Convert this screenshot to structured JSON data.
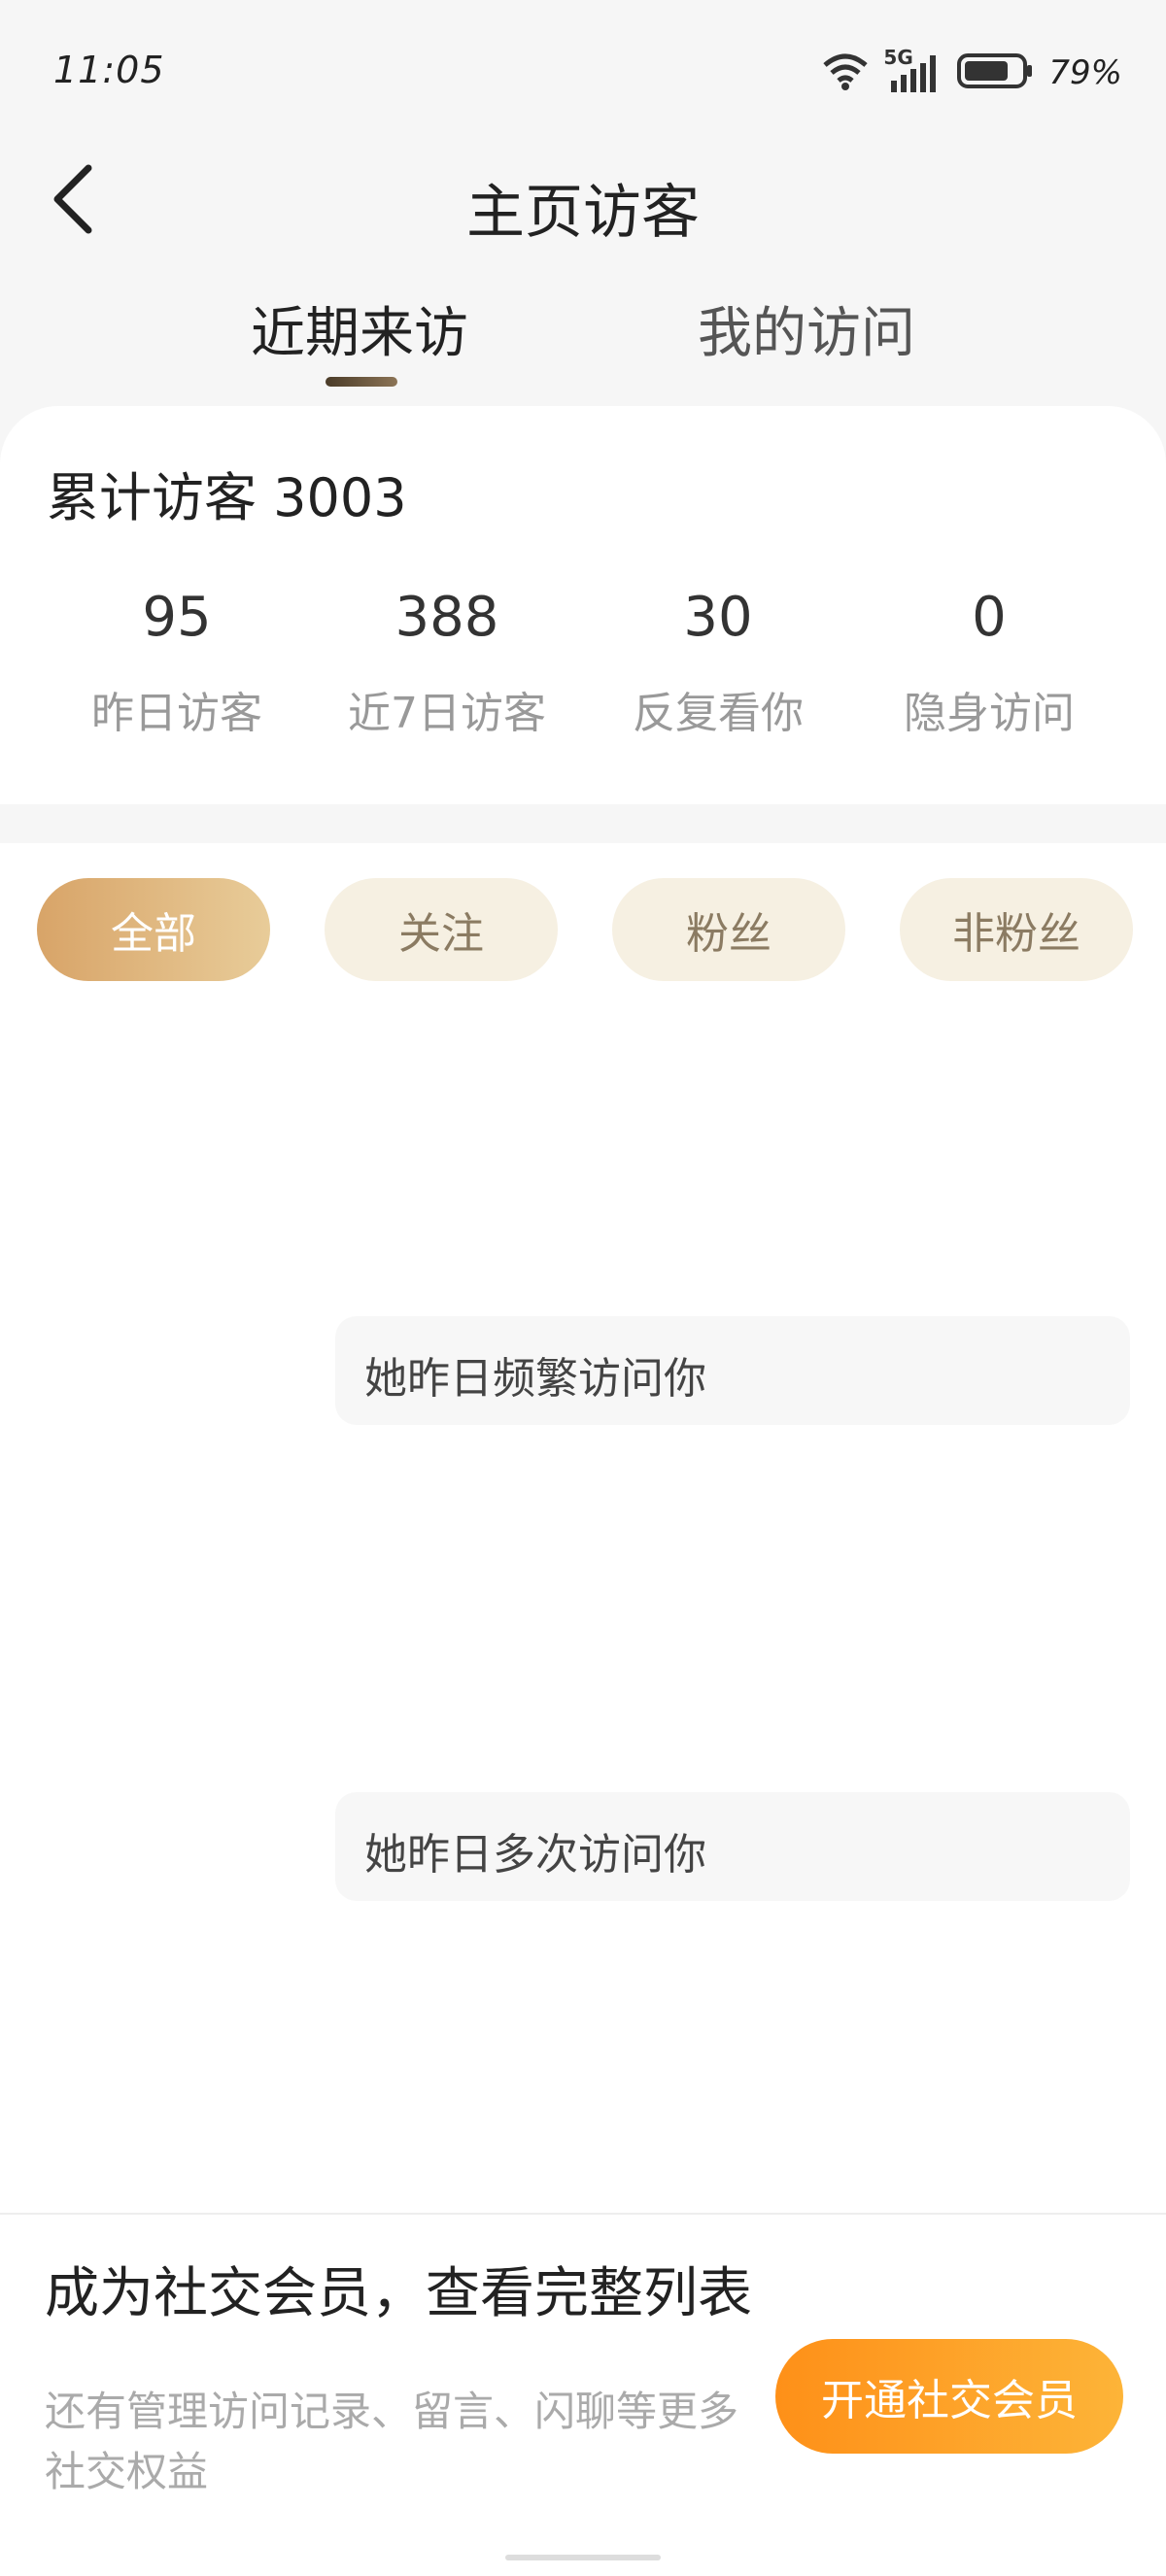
{
  "status_bar": {
    "time": "11:05",
    "network": "5G",
    "battery": "79%",
    "icons": [
      "wifi-icon",
      "signal-icon",
      "battery-icon"
    ]
  },
  "header": {
    "back_icon": "chevron-left-icon",
    "title": "主页访客"
  },
  "tabs": [
    {
      "label": "近期来访",
      "active": true
    },
    {
      "label": "我的访问",
      "active": false
    }
  ],
  "summary": {
    "total_label": "累计访客 3003",
    "stats": [
      {
        "value": "95",
        "label": "昨日访客"
      },
      {
        "value": "388",
        "label": "近7日访客"
      },
      {
        "value": "30",
        "label": "反复看你"
      },
      {
        "value": "0",
        "label": "隐身访问"
      }
    ]
  },
  "filters": [
    {
      "label": "全部",
      "active": true
    },
    {
      "label": "关注",
      "active": false
    },
    {
      "label": "粉丝",
      "active": false
    },
    {
      "label": "非粉丝",
      "active": false
    }
  ],
  "visitors": [
    {
      "text": "她昨日频繁访问你"
    },
    {
      "text": "她昨日多次访问你"
    }
  ],
  "promo": {
    "title": "成为社交会员，查看完整列表",
    "subtitle": "还有管理访问记录、留言、闪聊等更多社交权益",
    "button": "开通社交会员"
  },
  "colors": {
    "accent": "#fe9a22",
    "chip_active": "#dfb278",
    "chip_bg": "#f6f0e2",
    "chip_text": "#8b7b62"
  }
}
